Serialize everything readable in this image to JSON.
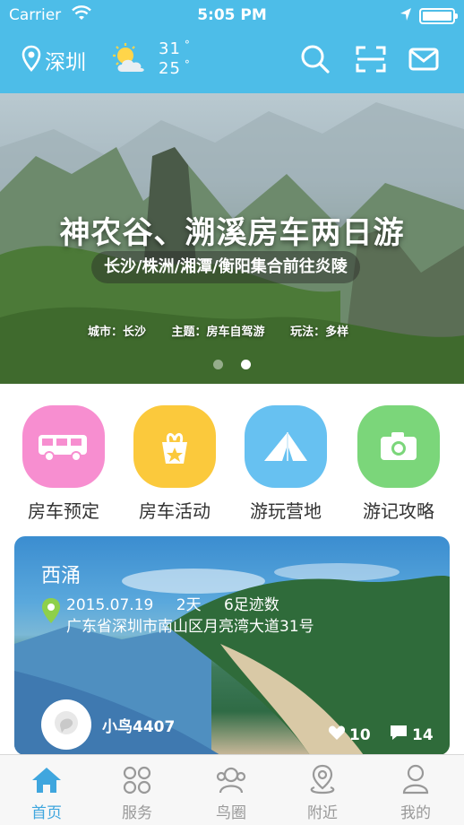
{
  "status_bar": {
    "carrier": "Carrier",
    "time": "5:05 PM"
  },
  "nav": {
    "city": "深圳",
    "temp_high": "31",
    "temp_low": "25",
    "icons": [
      "location-pin-icon",
      "weather-icon",
      "search-icon",
      "scan-icon",
      "message-icon"
    ]
  },
  "banner": {
    "title": "神农谷、溯溪房车两日游",
    "subtitle": "长沙/株洲/湘潭/衡阳集合前往炎陵",
    "city": "城市：长沙",
    "theme": "主题：房车自驾游",
    "play": "玩法：多样",
    "slides": 2,
    "active_slide": 2
  },
  "categories": [
    {
      "label": "房车预定",
      "icon": "rv-icon",
      "color": "#f78ed0"
    },
    {
      "label": "房车活动",
      "icon": "gift-icon",
      "color": "#fbc93c"
    },
    {
      "label": "游玩营地",
      "icon": "tent-icon",
      "color": "#67c1f1"
    },
    {
      "label": "游记攻略",
      "icon": "camera-icon",
      "color": "#7bd67a"
    }
  ],
  "card": {
    "place": "西涌",
    "date": "2015.07.19",
    "duration": "2天",
    "footprints": "6足迹数",
    "address": "广东省深圳市南山区月亮湾大道31号",
    "user": "小鸟4407",
    "likes": "10",
    "comments": "14"
  },
  "tabs": [
    {
      "label": "首页",
      "icon": "home-icon",
      "active": true
    },
    {
      "label": "服务",
      "icon": "services-icon",
      "active": false
    },
    {
      "label": "鸟圈",
      "icon": "community-icon",
      "active": false
    },
    {
      "label": "附近",
      "icon": "nearby-icon",
      "active": false
    },
    {
      "label": "我的",
      "icon": "profile-icon",
      "active": false
    }
  ],
  "colors": {
    "header": "#4dbde8",
    "tab_active": "#3fa6de",
    "tab_inactive": "#999999"
  }
}
